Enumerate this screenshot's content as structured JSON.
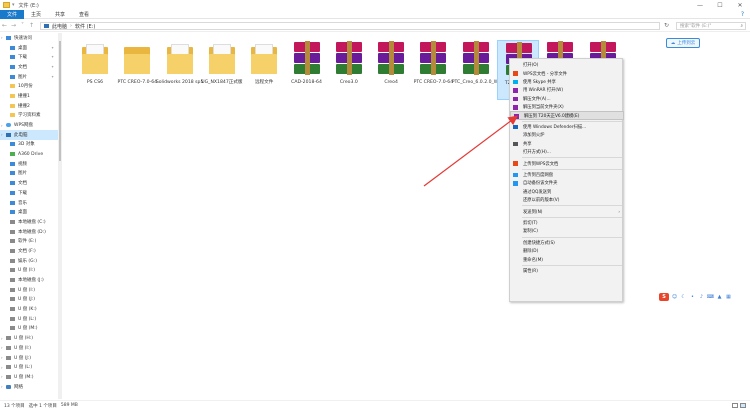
{
  "window": {
    "title": "文件 (E:)",
    "controls": [
      "—",
      "☐",
      "✕"
    ]
  },
  "ribbon": {
    "tabs": [
      "文件",
      "主页",
      "共享",
      "查看"
    ],
    "help": "?"
  },
  "address": {
    "crumbs": [
      "此电脑",
      "软件 (E:)"
    ],
    "search_placeholder": "搜索\"软件 (E:)\""
  },
  "sidebar": {
    "items": [
      {
        "label": "快速访问",
        "type": "group",
        "icon": "star-icon",
        "pinned": false
      },
      {
        "label": "桌面",
        "type": "item",
        "icon": "desktop-icon",
        "pinned": true
      },
      {
        "label": "下载",
        "type": "item",
        "icon": "download-icon",
        "pinned": true
      },
      {
        "label": "文档",
        "type": "item",
        "icon": "document-icon",
        "pinned": true
      },
      {
        "label": "图片",
        "type": "item",
        "icon": "picture-icon",
        "pinned": true
      },
      {
        "label": "10月份",
        "type": "item",
        "icon": "folder-icon",
        "pinned": false
      },
      {
        "label": "撞撞1",
        "type": "item",
        "icon": "folder-icon",
        "pinned": false
      },
      {
        "label": "撞撞2",
        "type": "item",
        "icon": "folder-icon",
        "pinned": false
      },
      {
        "label": "学习资料素",
        "type": "item",
        "icon": "folder-icon",
        "pinned": false
      },
      {
        "label": "WPS网盘",
        "type": "group",
        "icon": "cloud-icon",
        "pinned": false
      },
      {
        "label": "此电脑",
        "type": "group",
        "icon": "computer-icon",
        "pinned": false,
        "active": true
      },
      {
        "label": "3D 对象",
        "type": "item",
        "icon": "cube-icon",
        "pinned": false
      },
      {
        "label": "A360 Drive",
        "type": "item",
        "icon": "drive-icon",
        "pinned": false
      },
      {
        "label": "视频",
        "type": "item",
        "icon": "video-icon",
        "pinned": false
      },
      {
        "label": "图片",
        "type": "item",
        "icon": "picture-icon",
        "pinned": false
      },
      {
        "label": "文档",
        "type": "item",
        "icon": "document-icon",
        "pinned": false
      },
      {
        "label": "下载",
        "type": "item",
        "icon": "download-icon",
        "pinned": false
      },
      {
        "label": "音乐",
        "type": "item",
        "icon": "music-icon",
        "pinned": false
      },
      {
        "label": "桌面",
        "type": "item",
        "icon": "desktop-icon",
        "pinned": false
      },
      {
        "label": "本地磁盘 (C:)",
        "type": "item",
        "icon": "disk-icon",
        "pinned": false
      },
      {
        "label": "本地磁盘 (D:)",
        "type": "item",
        "icon": "disk-icon",
        "pinned": false
      },
      {
        "label": "软件 (E:)",
        "type": "item",
        "icon": "disk-icon",
        "pinned": false
      },
      {
        "label": "文档 (F:)",
        "type": "item",
        "icon": "disk-icon",
        "pinned": false
      },
      {
        "label": "娱乐 (G:)",
        "type": "item",
        "icon": "disk-icon",
        "pinned": false
      },
      {
        "label": "U 盘 (I:)",
        "type": "item",
        "icon": "usb-icon",
        "pinned": false
      },
      {
        "label": "本地磁盘 (J:)",
        "type": "item",
        "icon": "disk-icon",
        "pinned": false
      },
      {
        "label": "U 盘 (I:)",
        "type": "item",
        "icon": "usb-icon",
        "pinned": false
      },
      {
        "label": "U 盘 (J:)",
        "type": "item",
        "icon": "usb-icon",
        "pinned": false
      },
      {
        "label": "U 盘 (K:)",
        "type": "item",
        "icon": "usb-icon",
        "pinned": false
      },
      {
        "label": "U 盘 (L:)",
        "type": "item",
        "icon": "usb-icon",
        "pinned": false
      },
      {
        "label": "U 盘 (M:)",
        "type": "item",
        "icon": "usb-icon",
        "pinned": false
      },
      {
        "label": "U 盘 (H:)",
        "type": "group",
        "icon": "usb-icon",
        "pinned": false
      },
      {
        "label": "U 盘 (I:)",
        "type": "group",
        "icon": "usb-icon",
        "pinned": false
      },
      {
        "label": "U 盘 (J:)",
        "type": "group",
        "icon": "usb-icon",
        "pinned": false
      },
      {
        "label": "U 盘 (L:)",
        "type": "group",
        "icon": "usb-icon",
        "pinned": false
      },
      {
        "label": "U 盘 (M:)",
        "type": "group",
        "icon": "usb-icon",
        "pinned": false
      },
      {
        "label": "网络",
        "type": "group",
        "icon": "network-icon",
        "pinned": false
      }
    ]
  },
  "files": [
    {
      "label": "PS CS6",
      "kind": "folder"
    },
    {
      "label": "PTC CREO-7.0-64",
      "kind": "folder-plain"
    },
    {
      "label": "Solidworks 2018 sp5",
      "kind": "folder"
    },
    {
      "label": "UG_NX1847正式版",
      "kind": "folder"
    },
    {
      "label": "远程文件",
      "kind": "folder"
    },
    {
      "label": "CAD-2018-64",
      "kind": "rar"
    },
    {
      "label": "Creo3.0",
      "kind": "rar"
    },
    {
      "label": "Creo4",
      "kind": "rar"
    },
    {
      "label": "PTC CREO-7.0-64",
      "kind": "rar"
    },
    {
      "label": "PTC_Creo_6.0.2.0_Win64",
      "kind": "rar"
    },
    {
      "label": "T20天正V6.0",
      "kind": "rar",
      "selected": true
    },
    {
      "label": "",
      "kind": "rar"
    },
    {
      "label": "",
      "kind": "rar"
    }
  ],
  "upload_button": "上传到云",
  "context_menu": {
    "items": [
      {
        "label": "打开(O)",
        "icon": "",
        "type": "item"
      },
      {
        "label": "WPS云文档 - 分享文件",
        "icon": "wps-icon",
        "type": "item"
      },
      {
        "label": "使用 Skype 共享",
        "icon": "skype-icon",
        "type": "item"
      },
      {
        "label": "用 WinRAR 打开(W)",
        "icon": "winrar-icon",
        "type": "item"
      },
      {
        "label": "解压文件(A)...",
        "icon": "winrar-icon",
        "type": "item"
      },
      {
        "label": "解压到当前文件夹(X)",
        "icon": "winrar-icon",
        "type": "item"
      },
      {
        "label": "解压到 T20天正V6.0建模(E)",
        "icon": "winrar-icon",
        "type": "item",
        "highlighted": true
      },
      {
        "type": "sep"
      },
      {
        "label": "使用 Windows Defender扫描...",
        "icon": "defender-icon",
        "type": "item"
      },
      {
        "label": "添加到火炉",
        "icon": "",
        "type": "item"
      },
      {
        "label": "共享",
        "icon": "share-icon",
        "type": "item"
      },
      {
        "label": "打开方式(H)...",
        "icon": "",
        "type": "item"
      },
      {
        "type": "sep"
      },
      {
        "label": "上传到WPS云文档",
        "icon": "wps-icon",
        "type": "item"
      },
      {
        "type": "sep"
      },
      {
        "label": "上传到百度网盘",
        "icon": "baidu-icon",
        "type": "item"
      },
      {
        "label": "自动备份该文件夹",
        "icon": "baidu-icon",
        "type": "item"
      },
      {
        "label": "通过QQ发送到",
        "icon": "",
        "type": "item"
      },
      {
        "label": "还原以前的版本(V)",
        "icon": "",
        "type": "item"
      },
      {
        "type": "sep"
      },
      {
        "label": "发送到(N)",
        "icon": "",
        "type": "item",
        "submenu": true
      },
      {
        "type": "sep"
      },
      {
        "label": "剪切(T)",
        "icon": "",
        "type": "item"
      },
      {
        "label": "复制(C)",
        "icon": "",
        "type": "item"
      },
      {
        "type": "sep"
      },
      {
        "label": "创建快捷方式(S)",
        "icon": "",
        "type": "item"
      },
      {
        "label": "删除(D)",
        "icon": "",
        "type": "item"
      },
      {
        "label": "重命名(M)",
        "icon": "",
        "type": "item"
      },
      {
        "type": "sep"
      },
      {
        "label": "属性(R)",
        "icon": "",
        "type": "item"
      }
    ]
  },
  "ime_toolbar": {
    "brand": "S",
    "icons": [
      "smiley-icon",
      "moon-icon",
      "dots-icon",
      "mic-icon",
      "keyboard-icon",
      "shirt-icon",
      "grid-icon"
    ]
  },
  "status": {
    "count": "13 个项目",
    "selected": "选中 1 个项目",
    "size": "589 MB"
  },
  "colors": {
    "accent": "#1979ca",
    "selection": "#cce8ff",
    "arrow": "#e53935"
  }
}
